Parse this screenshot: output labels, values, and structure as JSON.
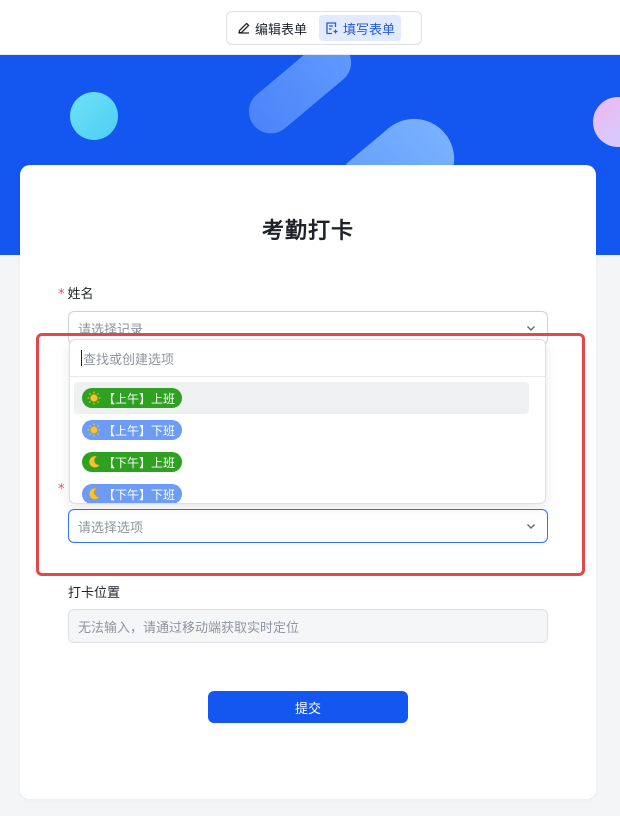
{
  "toolbar": {
    "edit_label": "编辑表单",
    "fill_label": "填写表单",
    "active_tab": "填写表单"
  },
  "form": {
    "title": "考勤打卡",
    "submit_label": "提交"
  },
  "fields": {
    "name": {
      "label": "姓名",
      "required": true,
      "placeholder": "请选择记录"
    },
    "type": {
      "required": true,
      "placeholder": "请选择选项"
    },
    "location": {
      "label": "打卡位置",
      "placeholder": "无法输入，请通过移动端获取实时定位"
    }
  },
  "dropdown": {
    "search_placeholder": "查找或创建选项",
    "options": [
      {
        "label": "【上午】上班",
        "icon": "sun-icon",
        "color": "#2ea121"
      },
      {
        "label": "【上午】下班",
        "icon": "sun-icon",
        "color": "#6d9cf6"
      },
      {
        "label": "【下午】上班",
        "icon": "moon-icon",
        "color": "#2ea121"
      },
      {
        "label": "【下午】下班",
        "icon": "moon-icon",
        "color": "#6d9cf6"
      }
    ]
  },
  "colors": {
    "brand": "#1456f0",
    "highlight": "#e0484a",
    "required": "#f54a45"
  }
}
